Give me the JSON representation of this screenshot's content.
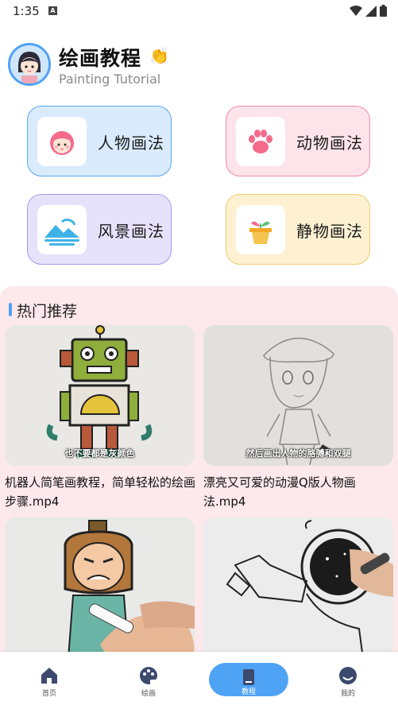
{
  "status": {
    "time": "1:35",
    "notif": "A"
  },
  "header": {
    "title": "绘画教程",
    "subtitle": "Painting Tutorial"
  },
  "categories": [
    {
      "label": "人物画法",
      "icon": "girl-face-icon"
    },
    {
      "label": "动物画法",
      "icon": "paw-icon"
    },
    {
      "label": "风景画法",
      "icon": "landscape-icon"
    },
    {
      "label": "静物画法",
      "icon": "flower-pot-icon"
    }
  ],
  "section": {
    "title": "热门推荐"
  },
  "videos": [
    {
      "title": "机器人简笔画教程，简单轻松的绘画步骤.mp4",
      "caption": "也不要都是灰颜色"
    },
    {
      "title": "漂亮又可爱的动漫Q版人物画法.mp4",
      "caption": "然后画出人物的胳膊和双腿"
    },
    {
      "title": "",
      "caption": ""
    },
    {
      "title": "",
      "caption": ""
    }
  ],
  "nav": [
    {
      "label": "首页",
      "icon": "home-icon"
    },
    {
      "label": "绘画",
      "icon": "palette-icon"
    },
    {
      "label": "教程",
      "icon": "book-icon"
    },
    {
      "label": "我的",
      "icon": "profile-icon"
    }
  ],
  "colors": {
    "accent": "#4ea3f5",
    "section_bg": "#fde8ec"
  }
}
